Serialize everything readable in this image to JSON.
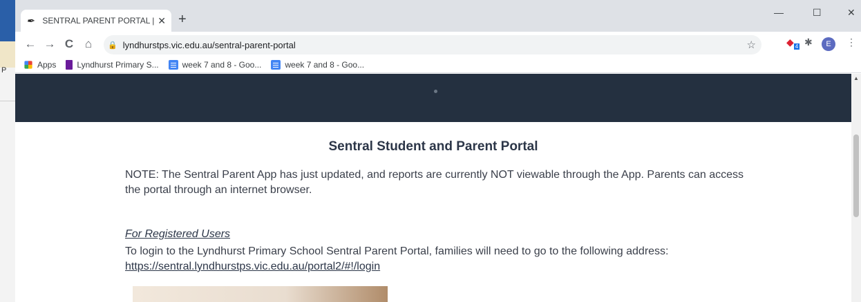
{
  "tab": {
    "title": "SENTRAL PARENT PORTAL | Lyndhurst Primary School",
    "close": "✕"
  },
  "new_tab": "+",
  "window": {
    "minimize": "—",
    "maximize": "☐",
    "close": "✕"
  },
  "nav": {
    "back": "←",
    "forward": "→",
    "reload": "C",
    "home": "⌂"
  },
  "omnibox": {
    "url": "lyndhurstps.vic.edu.au/sentral-parent-portal",
    "star": "☆"
  },
  "ext_badge": "4",
  "avatar_letter": "E",
  "menu": "⋮",
  "bookmarks": [
    {
      "label": "Apps"
    },
    {
      "label": "Lyndhurst Primary S..."
    },
    {
      "label": "week 7 and 8 - Goo..."
    },
    {
      "label": "week 7 and 8 - Goo..."
    }
  ],
  "side_letter": "P",
  "content": {
    "heading": "Sentral Student and Parent Portal",
    "note": "NOTE: The Sentral Parent App has just updated, and reports are currently NOT viewable through the App. Parents can access the portal through an internet browser.",
    "registered_heading": "For Registered Users",
    "registered_text": "To login to the Lyndhurst Primary School Sentral Parent Portal, families will need to go to the following address: ",
    "login_link": "https://sentral.lyndhurstps.vic.edu.au/portal2/#!/login"
  }
}
